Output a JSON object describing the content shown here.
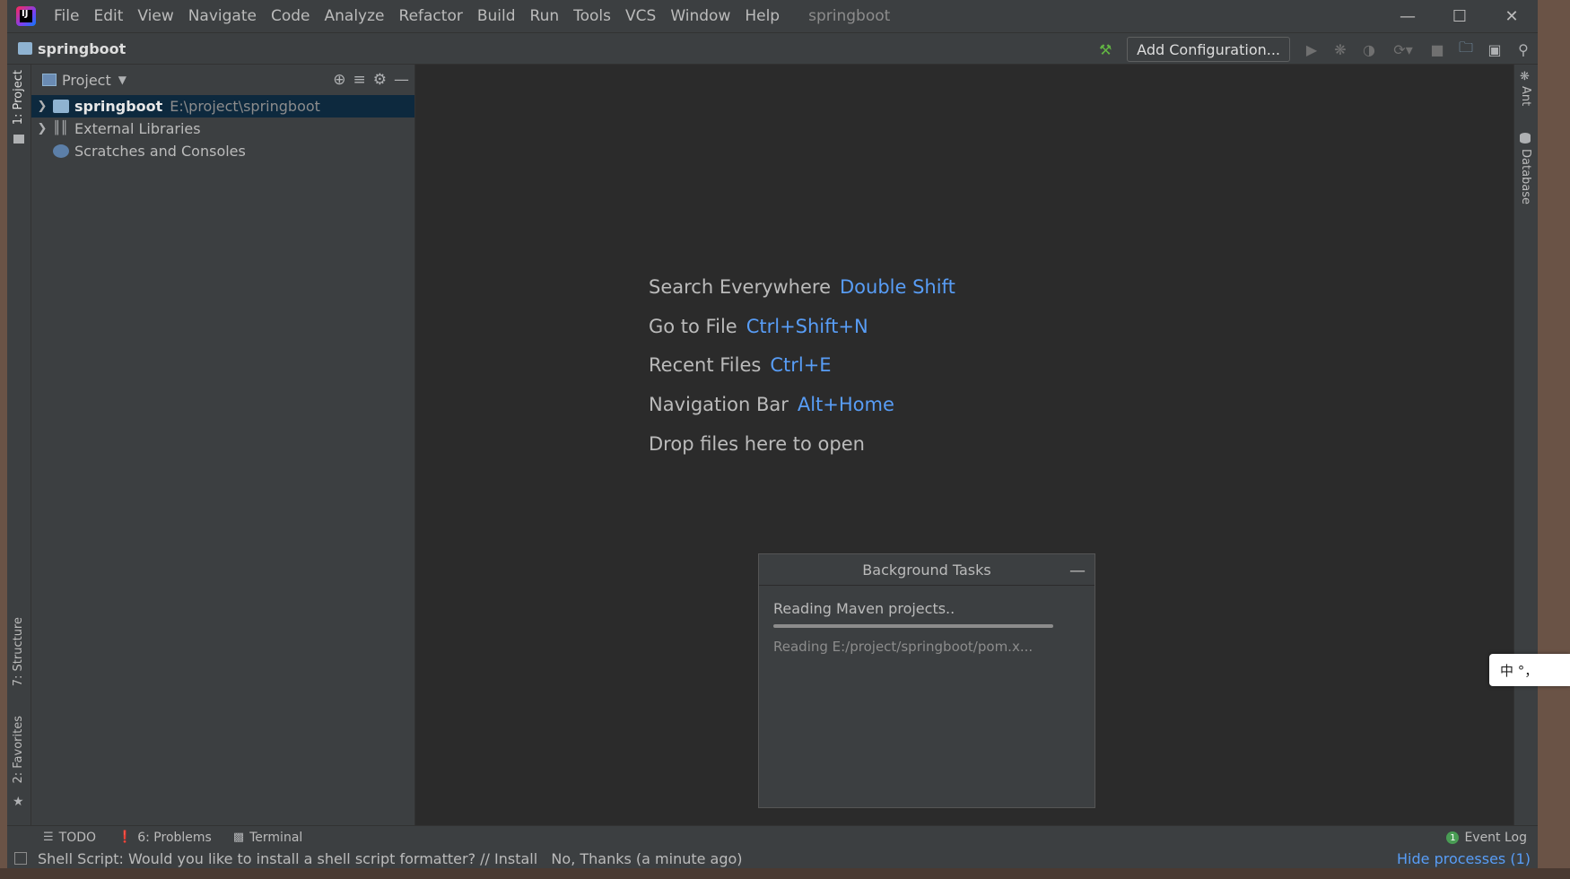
{
  "menubar": {
    "items": [
      "File",
      "Edit",
      "View",
      "Navigate",
      "Code",
      "Analyze",
      "Refactor",
      "Build",
      "Run",
      "Tools",
      "VCS",
      "Window",
      "Help"
    ],
    "window_title": "springboot"
  },
  "navbar": {
    "breadcrumb": "springboot",
    "add_config_label": "Add Configuration..."
  },
  "left_strip": {
    "project_tab": "1: Project",
    "structure_tab": "7: Structure",
    "favorites_tab": "2: Favorites"
  },
  "right_strip": {
    "ant_tab": "Ant",
    "database_tab": "Database"
  },
  "project_panel": {
    "title": "Project",
    "tree": [
      {
        "name": "springboot",
        "path": "E:\\project\\springboot"
      },
      {
        "name": "External Libraries"
      },
      {
        "name": "Scratches and Consoles"
      }
    ]
  },
  "editor": {
    "hints": [
      {
        "label": "Search Everywhere",
        "key": "Double Shift"
      },
      {
        "label": "Go to File",
        "key": "Ctrl+Shift+N"
      },
      {
        "label": "Recent Files",
        "key": "Ctrl+E"
      },
      {
        "label": "Navigation Bar",
        "key": "Alt+Home"
      }
    ],
    "drop_text": "Drop files here to open"
  },
  "background_tasks": {
    "title": "Background Tasks",
    "task": "Reading Maven projects..",
    "progress": 1.0,
    "detail": "Reading E:/project/springboot/pom.x..."
  },
  "tool_tabs": {
    "todo": "TODO",
    "problems": "6: Problems",
    "terminal": "Terminal",
    "event_log": "Event Log",
    "event_count": "1"
  },
  "statusbar": {
    "message": "Shell Script: Would you like to install a shell script formatter? // Install   No, Thanks (a minute ago)",
    "hide_processes": "Hide processes (1)"
  },
  "ime": {
    "text": "中 °，"
  },
  "colors": {
    "accent": "#589df6",
    "selection": "#0d293e",
    "panel": "#3c3f41",
    "editor": "#2b2b2b"
  }
}
